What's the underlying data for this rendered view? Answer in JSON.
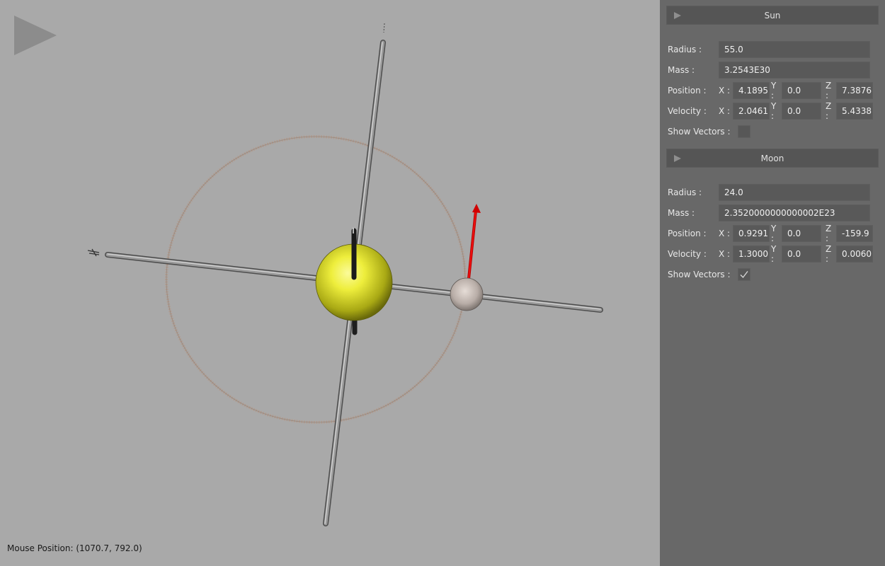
{
  "viewport": {
    "mouse_position_label": "Mouse Position: (1070.7, 792.0)",
    "background_color": "#a9a9a9",
    "sun_color": "#e6e63c",
    "moon_color": "#bcb2ac",
    "velocity_vector_color": "#e00000",
    "orbit_color": "#b09a8e"
  },
  "panel": {
    "sun": {
      "title": "Sun",
      "radius_label": "Radius :",
      "radius": "55.0",
      "mass_label": "Mass :",
      "mass": "3.2543E30",
      "position_label": "Position :",
      "position": {
        "x_label": "X :",
        "x": "4.1895",
        "y_label": "Y :",
        "y": "0.0",
        "z_label": "Z :",
        "z": "7.3876"
      },
      "velocity_label": "Velocity :",
      "velocity": {
        "x_label": "X :",
        "x": "2.0461",
        "y_label": "Y :",
        "y": "0.0",
        "z_label": "Z :",
        "z": "5.4338"
      },
      "show_vectors_label": "Show Vectors :",
      "show_vectors": false
    },
    "moon": {
      "title": "Moon",
      "radius_label": "Radius :",
      "radius": "24.0",
      "mass_label": "Mass :",
      "mass": "2.3520000000000002E23",
      "position_label": "Position :",
      "position": {
        "x_label": "X :",
        "x": "0.9291",
        "y_label": "Y :",
        "y": "0.0",
        "z_label": "Z :",
        "z": "-159.9"
      },
      "velocity_label": "Velocity :",
      "velocity": {
        "x_label": "X :",
        "x": "1.3000",
        "y_label": "Y :",
        "y": "0.0",
        "z_label": "Z :",
        "z": "0.0060"
      },
      "show_vectors_label": "Show Vectors :",
      "show_vectors": true
    }
  },
  "icons": {
    "play": "play-icon",
    "collapse_arrow": "triangle-right-icon",
    "checkmark": "checkmark-icon"
  }
}
